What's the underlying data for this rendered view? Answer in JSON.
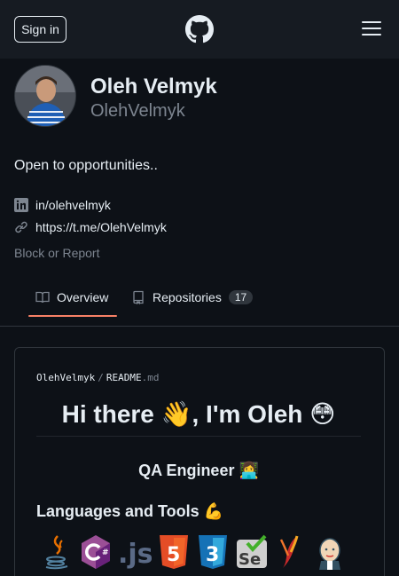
{
  "header": {
    "sign_in_label": "Sign in",
    "logo_icon": "github-icon",
    "menu_icon": "hamburger-icon"
  },
  "profile": {
    "full_name": "Oleh Velmyk",
    "username": "OlehVelmyk",
    "bio": "Open to opportunities..",
    "links": [
      {
        "icon": "linkedin-icon",
        "text": "in/olehvelmyk"
      },
      {
        "icon": "link-icon",
        "text": "https://t.me/OlehVelmyk"
      }
    ],
    "block_report": "Block or Report"
  },
  "tabs": [
    {
      "icon": "book-icon",
      "label": "Overview",
      "selected": true
    },
    {
      "icon": "repo-icon",
      "label": "Repositories",
      "count": "17"
    }
  ],
  "readme": {
    "owner": "OlehVelmyk",
    "separator": "/",
    "file_name": "README",
    "file_ext": ".md",
    "heading": "Hi there 👋, I'm Oleh 😳",
    "role": "QA Engineer 👩‍💻",
    "tools_heading": "Languages and Tools 💪",
    "tools": [
      "java-icon",
      "csharp-icon",
      "js-icon",
      "html5-icon",
      "css3-icon",
      "selenium-icon",
      "maven-icon",
      "jenkins-icon"
    ]
  },
  "colors": {
    "background": "#0d1117",
    "header": "#161b22",
    "border": "#30363d",
    "muted_text": "#7d8590",
    "tab_underline": "#f78166"
  }
}
